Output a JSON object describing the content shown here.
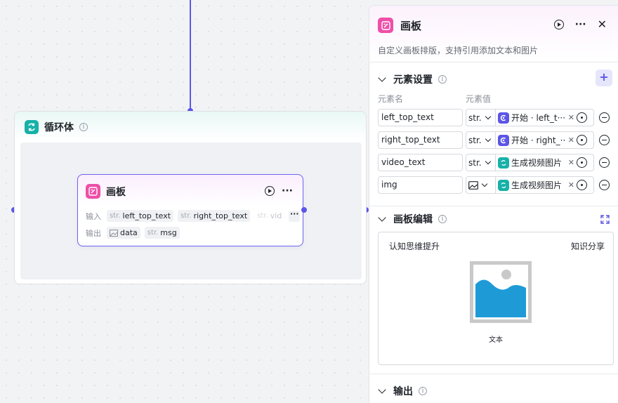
{
  "loop_node": {
    "title": "循环体"
  },
  "canvas_node": {
    "title": "画板",
    "input_label": "输入",
    "output_label": "输出",
    "inputs": [
      {
        "type": "str.",
        "name": "left_top_text"
      },
      {
        "type": "str.",
        "name": "right_top_text"
      },
      {
        "type": "str.",
        "name": "vid"
      }
    ],
    "outputs": [
      {
        "type": "img",
        "name": "data"
      },
      {
        "type": "str.",
        "name": "msg"
      }
    ],
    "more": "···"
  },
  "panel": {
    "title": "画板",
    "description": "自定义画板排版，支持引用添加文本和图片",
    "elements_section": {
      "title": "元素设置",
      "add_label": "+",
      "col_name": "元素名",
      "col_value": "元素值",
      "rows": [
        {
          "name": "left_top_text",
          "type": "str.",
          "ref_icon": "start-icon",
          "ref_text": "开始 · left_t···"
        },
        {
          "name": "right_top_text",
          "type": "str.",
          "ref_icon": "start-icon",
          "ref_text": "开始 · right_···"
        },
        {
          "name": "video_text",
          "type": "str.",
          "ref_icon": "loop-icon",
          "ref_text": "生成视频图片 · \""
        },
        {
          "name": "img",
          "type": "image-icon",
          "ref_icon": "loop-icon",
          "ref_text": "生成视频图片 · \""
        }
      ]
    },
    "canvas_section": {
      "title": "画板编辑",
      "top_left_text": "认知思维提升",
      "top_right_text": "知识分享",
      "caption": "文本"
    },
    "output_section": {
      "title": "输出"
    }
  },
  "colors": {
    "accent": "#5b55e8",
    "teal": "#17b1a8",
    "pink": "#ee4fa8",
    "image_blue": "#1e9bd7"
  }
}
